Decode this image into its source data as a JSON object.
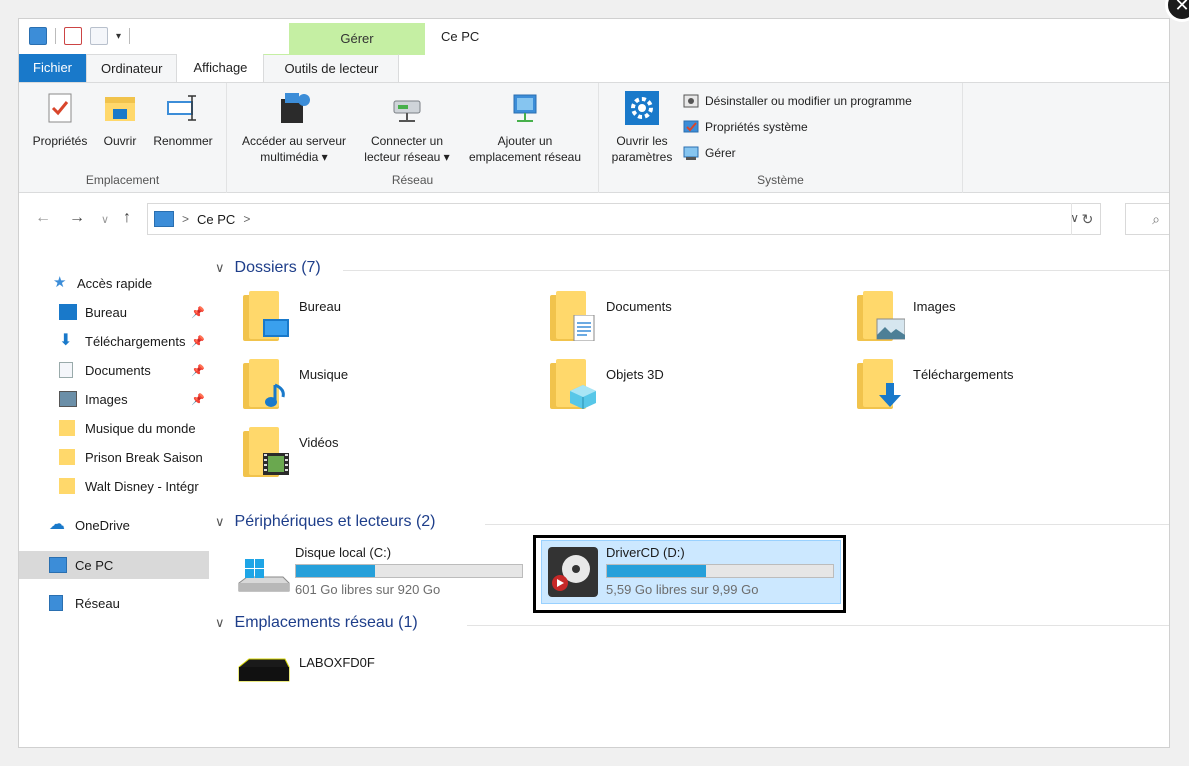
{
  "window": {
    "title": "Ce PC",
    "close": "✕"
  },
  "tabs": {
    "contextual_group": "Gérer",
    "items": [
      "Fichier",
      "Ordinateur",
      "Affichage",
      "Outils de lecteur"
    ]
  },
  "ribbon": {
    "groups": [
      {
        "title": "Emplacement",
        "buttons": [
          "Propriétés",
          "Ouvrir",
          "Renommer"
        ]
      },
      {
        "title": "Réseau",
        "buttons": [
          "Accéder au serveur multimédia ▾",
          "Connecter un lecteur réseau ▾",
          "Ajouter un emplacement réseau"
        ]
      },
      {
        "title": "Système",
        "buttons": [
          "Ouvrir les paramètres"
        ],
        "small": [
          "Désinstaller ou modifier un programme",
          "Propriétés système",
          "Gérer"
        ]
      }
    ],
    "accaddr": "Accéder au serveur",
    "accaddr2": "multimédia ▾",
    "connect": "Connecter un",
    "connect2": "lecteur réseau ▾",
    "add": "Ajouter un",
    "add2": "emplacement réseau",
    "open_settings": "Ouvrir les",
    "open_settings2": "paramètres"
  },
  "address": {
    "path": "Ce PC",
    "sep": ">"
  },
  "sidebar": {
    "quick_access": "Accès rapide",
    "items": [
      {
        "label": "Bureau",
        "pinned": true
      },
      {
        "label": "Téléchargements",
        "pinned": true
      },
      {
        "label": "Documents",
        "pinned": true
      },
      {
        "label": "Images",
        "pinned": true
      },
      {
        "label": "Musique du monde",
        "pinned": false
      },
      {
        "label": "Prison Break Saison",
        "pinned": false
      },
      {
        "label": "Walt Disney - Intégr",
        "pinned": false
      }
    ],
    "onedrive": "OneDrive",
    "this_pc": "Ce PC",
    "network": "Réseau"
  },
  "content": {
    "folders_header": "Dossiers (7)",
    "folders": [
      "Bureau",
      "Documents",
      "Images",
      "Musique",
      "Objets 3D",
      "Téléchargements",
      "Vidéos"
    ],
    "devices_header": "Périphériques et lecteurs (2)",
    "drives": [
      {
        "name": "Disque local (C:)",
        "free": "601 Go libres sur 920 Go",
        "used_fraction": 0.35
      },
      {
        "name": "DriverCD (D:)",
        "free": "5,59 Go libres sur 9,99 Go",
        "used_fraction": 0.44
      }
    ],
    "network_header": "Emplacements réseau (1)",
    "network_items": [
      "LABOXFD0F"
    ]
  },
  "colors": {
    "accent": "#1979ca",
    "manage_tab": "#c5efa3",
    "bar_fill": "#26a0da",
    "selection": "#cce8ff"
  }
}
